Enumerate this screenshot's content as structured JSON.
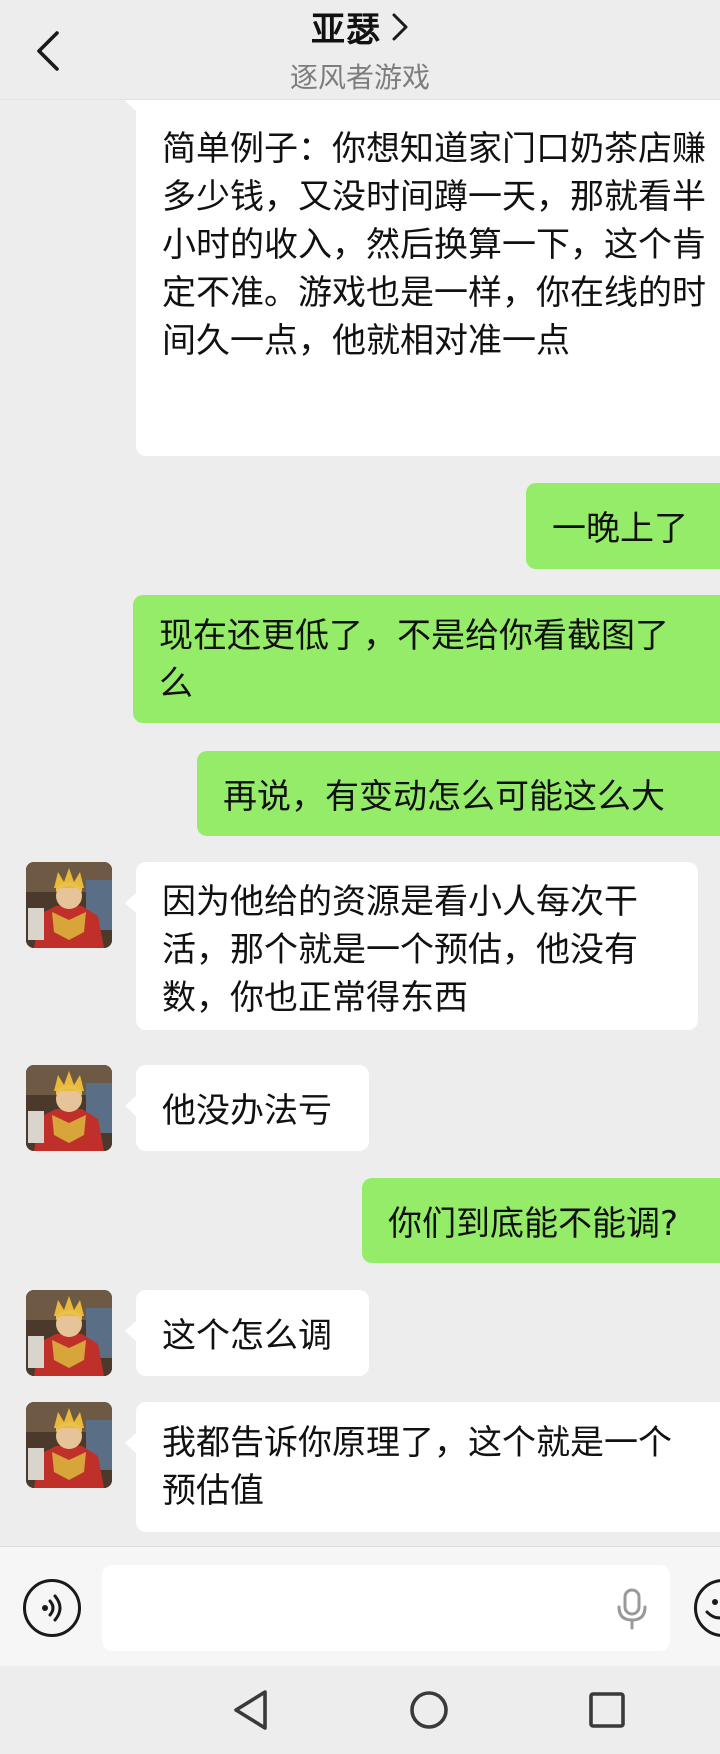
{
  "header": {
    "title": "亚瑟",
    "subtitle": "逐风者游戏"
  },
  "messages": [
    {
      "side": "left",
      "avatar": false,
      "text": "简单例子：你想知道家门口奶茶店赚多少钱，又没时间蹲一天，那就看半小时的收入，然后换算一下，这个肯定不准。游戏也是一样，你在线的时间久一点，他就相对准一点"
    },
    {
      "side": "right",
      "text": "一晚上了"
    },
    {
      "side": "right",
      "text": "现在还更低了，不是给你看截图了么"
    },
    {
      "side": "right",
      "text": "再说，有变动怎么可能这么大"
    },
    {
      "side": "left",
      "avatar": true,
      "text": "因为他给的资源是看小人每次干活，那个就是一个预估，他没有数，你也正常得东西"
    },
    {
      "side": "left",
      "avatar": true,
      "text": "他没办法亏"
    },
    {
      "side": "right",
      "text": "你们到底能不能调?"
    },
    {
      "side": "left",
      "avatar": true,
      "text": "这个怎么调"
    },
    {
      "side": "left",
      "avatar": true,
      "text": "我都告诉你原理了，这个就是一个预估值"
    }
  ],
  "input": {
    "value": "",
    "placeholder": ""
  },
  "colors": {
    "background": "#ededed",
    "bubble_self": "#95ec69",
    "bubble_other": "#ffffff",
    "subtitle": "#7d7d7d"
  },
  "icons": {
    "back": "chevron-left-icon",
    "title_arrow": "chevron-right-icon",
    "voice": "voice-icon",
    "mic": "microphone-icon",
    "emoji": "emoji-icon",
    "nav_back": "triangle-back-icon",
    "nav_home": "circle-home-icon",
    "nav_recents": "square-recents-icon"
  }
}
